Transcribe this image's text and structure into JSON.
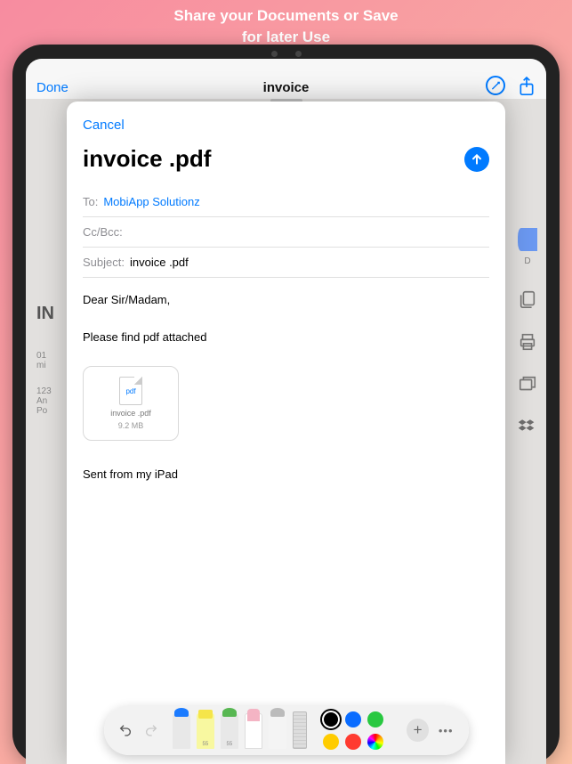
{
  "promo": {
    "line1": "Share your Documents or Save",
    "line2": "for later Use"
  },
  "background_app": {
    "done_label": "Done",
    "title": "invoice",
    "doc_word": "IN",
    "share_options": [
      {
        "icon": "bluetooth-icon",
        "label": "D"
      }
    ]
  },
  "mail": {
    "cancel_label": "Cancel",
    "title": "invoice .pdf",
    "to_label": "To:",
    "to_value": "MobiApp Solutionz",
    "ccbcc_label": "Cc/Bcc:",
    "subject_label": "Subject:",
    "subject_value": "invoice .pdf",
    "body_line1": "Dear Sir/Madam,",
    "body_line2": "Please find pdf attached",
    "attachment": {
      "pdf_label": "pdf",
      "name": "invoice .pdf",
      "size": "9.2 MB"
    },
    "signature": "Sent from my iPad"
  },
  "markup_toolbar": {
    "tools": [
      {
        "name": "pen",
        "label": ""
      },
      {
        "name": "marker",
        "label": "55"
      },
      {
        "name": "pencil",
        "label": "55"
      },
      {
        "name": "eraser",
        "label": ""
      },
      {
        "name": "lasso",
        "label": ""
      },
      {
        "name": "ruler",
        "label": ""
      }
    ],
    "colors": {
      "black": "#000000",
      "blue": "#0a6cff",
      "green": "#28c840",
      "yellow": "#ffcc00",
      "red": "#ff3b30"
    }
  }
}
